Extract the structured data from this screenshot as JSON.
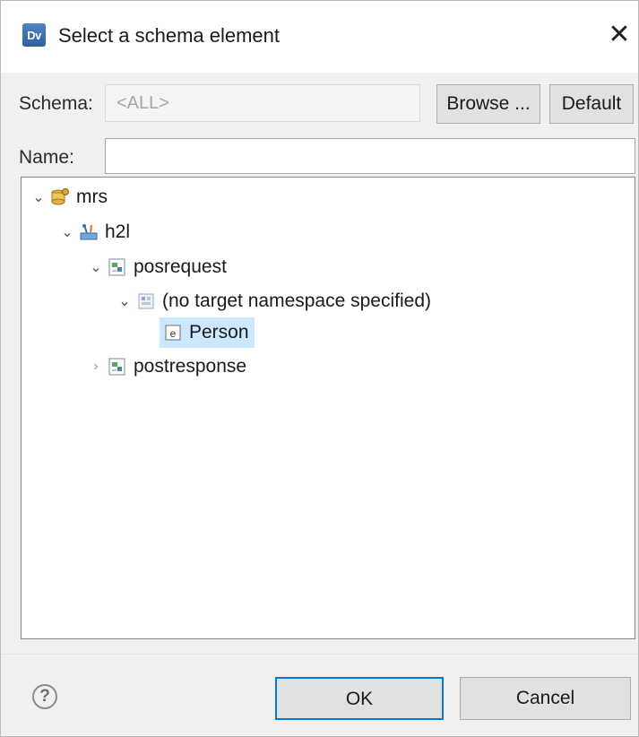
{
  "dialog": {
    "title": "Select a schema element",
    "app_icon_text": "Dv"
  },
  "schema": {
    "label": "Schema:",
    "value": "<ALL>",
    "browse_label": "Browse ...",
    "default_label": "Default"
  },
  "name": {
    "label": "Name:",
    "value": ""
  },
  "tree": {
    "items": [
      {
        "label": "mrs",
        "expanded": true,
        "icon": "jar-icon"
      },
      {
        "label": "h2l",
        "expanded": true,
        "icon": "model-project-icon"
      },
      {
        "label": "posrequest",
        "expanded": true,
        "icon": "schema-file-icon"
      },
      {
        "label": "(no target namespace specified)",
        "expanded": true,
        "icon": "namespace-icon"
      },
      {
        "label": "Person",
        "selected": true,
        "icon": "element-icon",
        "badge": "e"
      },
      {
        "label": "postresponse",
        "expanded": false,
        "icon": "schema-file-icon"
      }
    ]
  },
  "footer": {
    "ok_label": "OK",
    "cancel_label": "Cancel",
    "help_glyph": "?"
  },
  "colors": {
    "selection": "#cce8ff",
    "ok_border": "#0078d7"
  }
}
